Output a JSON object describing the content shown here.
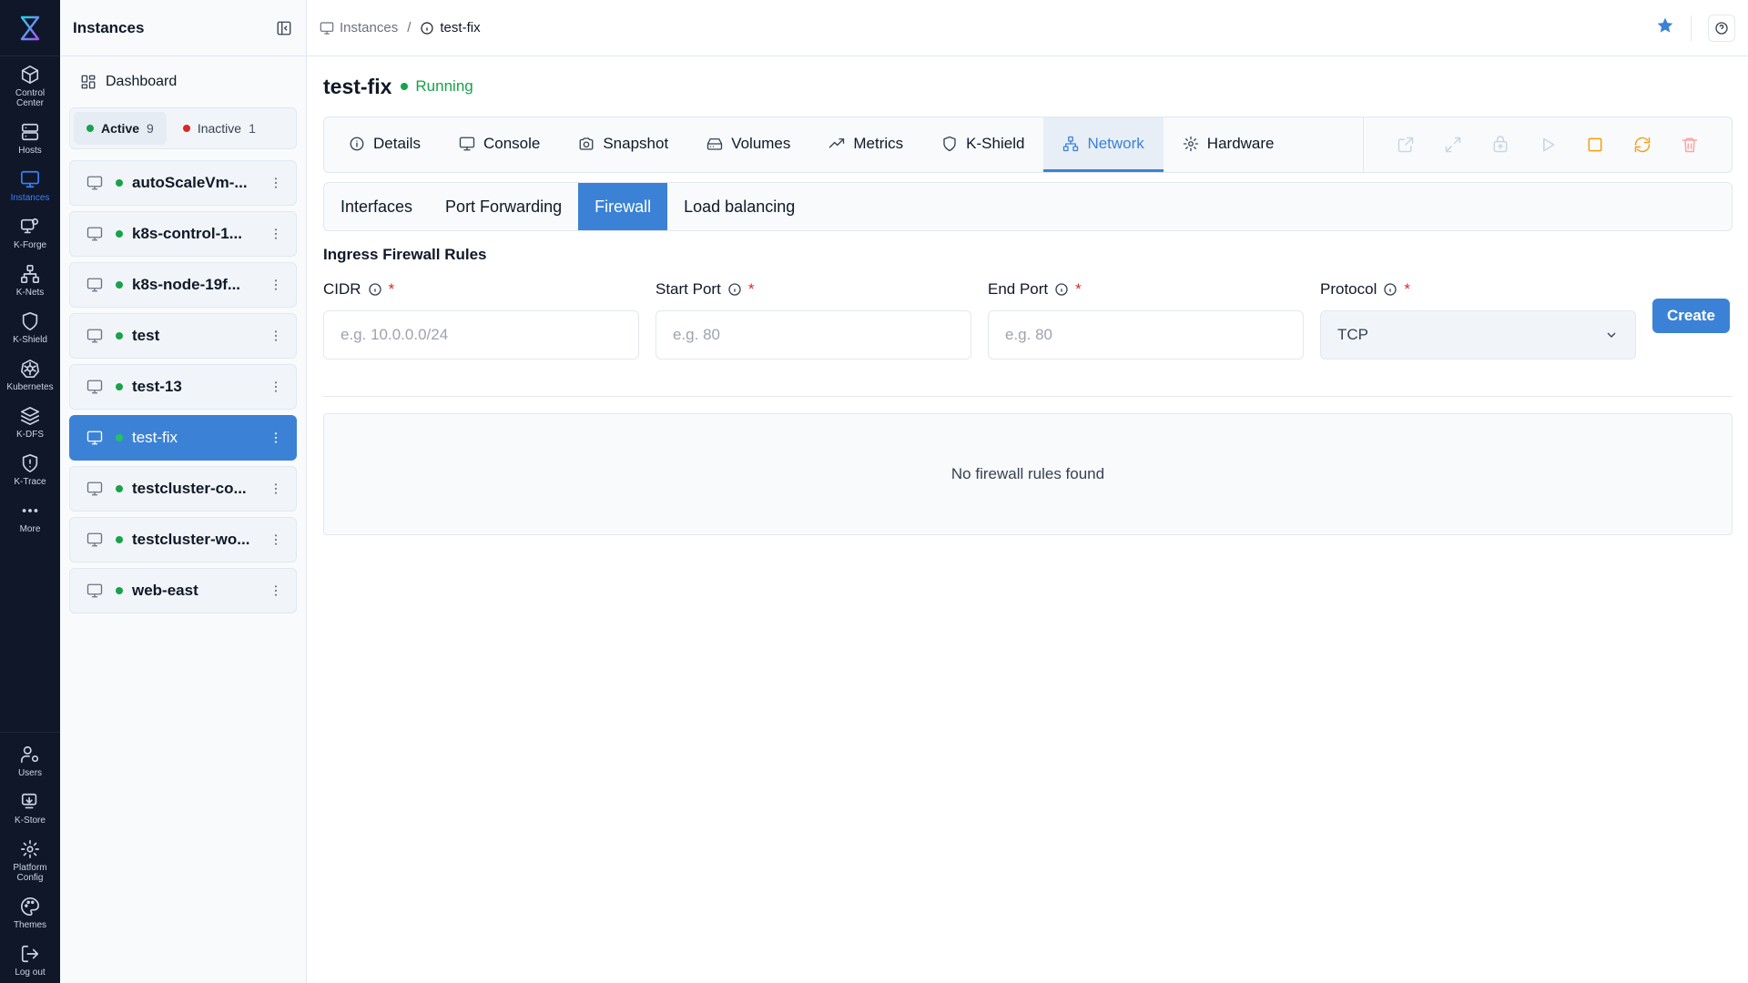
{
  "rail": {
    "items": [
      {
        "label": "Control\nCenter",
        "icon": "cube-icon"
      },
      {
        "label": "Hosts",
        "icon": "server-icon"
      },
      {
        "label": "Instances",
        "icon": "monitor-icon"
      },
      {
        "label": "K-Forge",
        "icon": "forge-icon"
      },
      {
        "label": "K-Nets",
        "icon": "network-icon"
      },
      {
        "label": "K-Shield",
        "icon": "shield-icon"
      },
      {
        "label": "Kubernetes",
        "icon": "kubernetes-icon"
      },
      {
        "label": "K-DFS",
        "icon": "layers-icon"
      },
      {
        "label": "K-Trace",
        "icon": "trace-icon"
      },
      {
        "label": "More",
        "icon": "more-icon"
      }
    ],
    "bottom": [
      {
        "label": "Users",
        "icon": "users-icon"
      },
      {
        "label": "K-Store",
        "icon": "store-icon"
      },
      {
        "label": "Platform\nConfig",
        "icon": "gear-icon"
      },
      {
        "label": "Themes",
        "icon": "palette-icon"
      },
      {
        "label": "Log out",
        "icon": "logout-icon"
      }
    ]
  },
  "sidebar": {
    "title": "Instances",
    "dashboard": "Dashboard",
    "filter": {
      "active_label": "Active",
      "active_count": "9",
      "inactive_label": "Inactive",
      "inactive_count": "1",
      "active_color": "#16a34a",
      "inactive_color": "#dc2626"
    },
    "instances": [
      "autoScaleVm-...",
      "k8s-control-1...",
      "k8s-node-19f...",
      "test",
      "test-13",
      "test-fix",
      "testcluster-co...",
      "testcluster-wo...",
      "web-east"
    ],
    "selected": "test-fix"
  },
  "breadcrumb": {
    "root": "Instances",
    "separator": "/",
    "current": "test-fix"
  },
  "instance": {
    "name": "test-fix",
    "status": "Running"
  },
  "tabs": [
    {
      "label": "Details",
      "icon": "info-icon"
    },
    {
      "label": "Console",
      "icon": "monitor-icon"
    },
    {
      "label": "Snapshot",
      "icon": "camera-icon"
    },
    {
      "label": "Volumes",
      "icon": "drive-icon"
    },
    {
      "label": "Metrics",
      "icon": "trend-icon"
    },
    {
      "label": "K-Shield",
      "icon": "shield-icon"
    },
    {
      "label": "Network",
      "icon": "network-icon"
    },
    {
      "label": "Hardware",
      "icon": "gear-icon"
    }
  ],
  "active_tab": "Network",
  "actions": [
    {
      "name": "open-external",
      "color": "#cbd5e1"
    },
    {
      "name": "expand",
      "color": "#cbd5e1"
    },
    {
      "name": "migrate",
      "color": "#cbd5e1"
    },
    {
      "name": "start",
      "color": "#cbd5e1"
    },
    {
      "name": "stop",
      "color": "#f59e0b"
    },
    {
      "name": "restart",
      "color": "#f59e0b"
    },
    {
      "name": "delete",
      "color": "#fca5a5"
    }
  ],
  "subtabs": [
    "Interfaces",
    "Port Forwarding",
    "Firewall",
    "Load balancing"
  ],
  "active_subtab": "Firewall",
  "firewall": {
    "section_title": "Ingress Firewall Rules",
    "cidr_label": "CIDR",
    "cidr_placeholder": "e.g. 10.0.0.0/24",
    "start_label": "Start Port",
    "start_placeholder": "e.g. 80",
    "end_label": "End Port",
    "end_placeholder": "e.g. 80",
    "protocol_label": "Protocol",
    "protocol_value": "TCP",
    "required_mark": "*",
    "create_label": "Create",
    "empty_text": "No firewall rules found"
  },
  "colors": {
    "accent": "#3b82d6",
    "running": "#16a34a",
    "rail_bg": "#0f1729",
    "star": "#3b82d6"
  }
}
